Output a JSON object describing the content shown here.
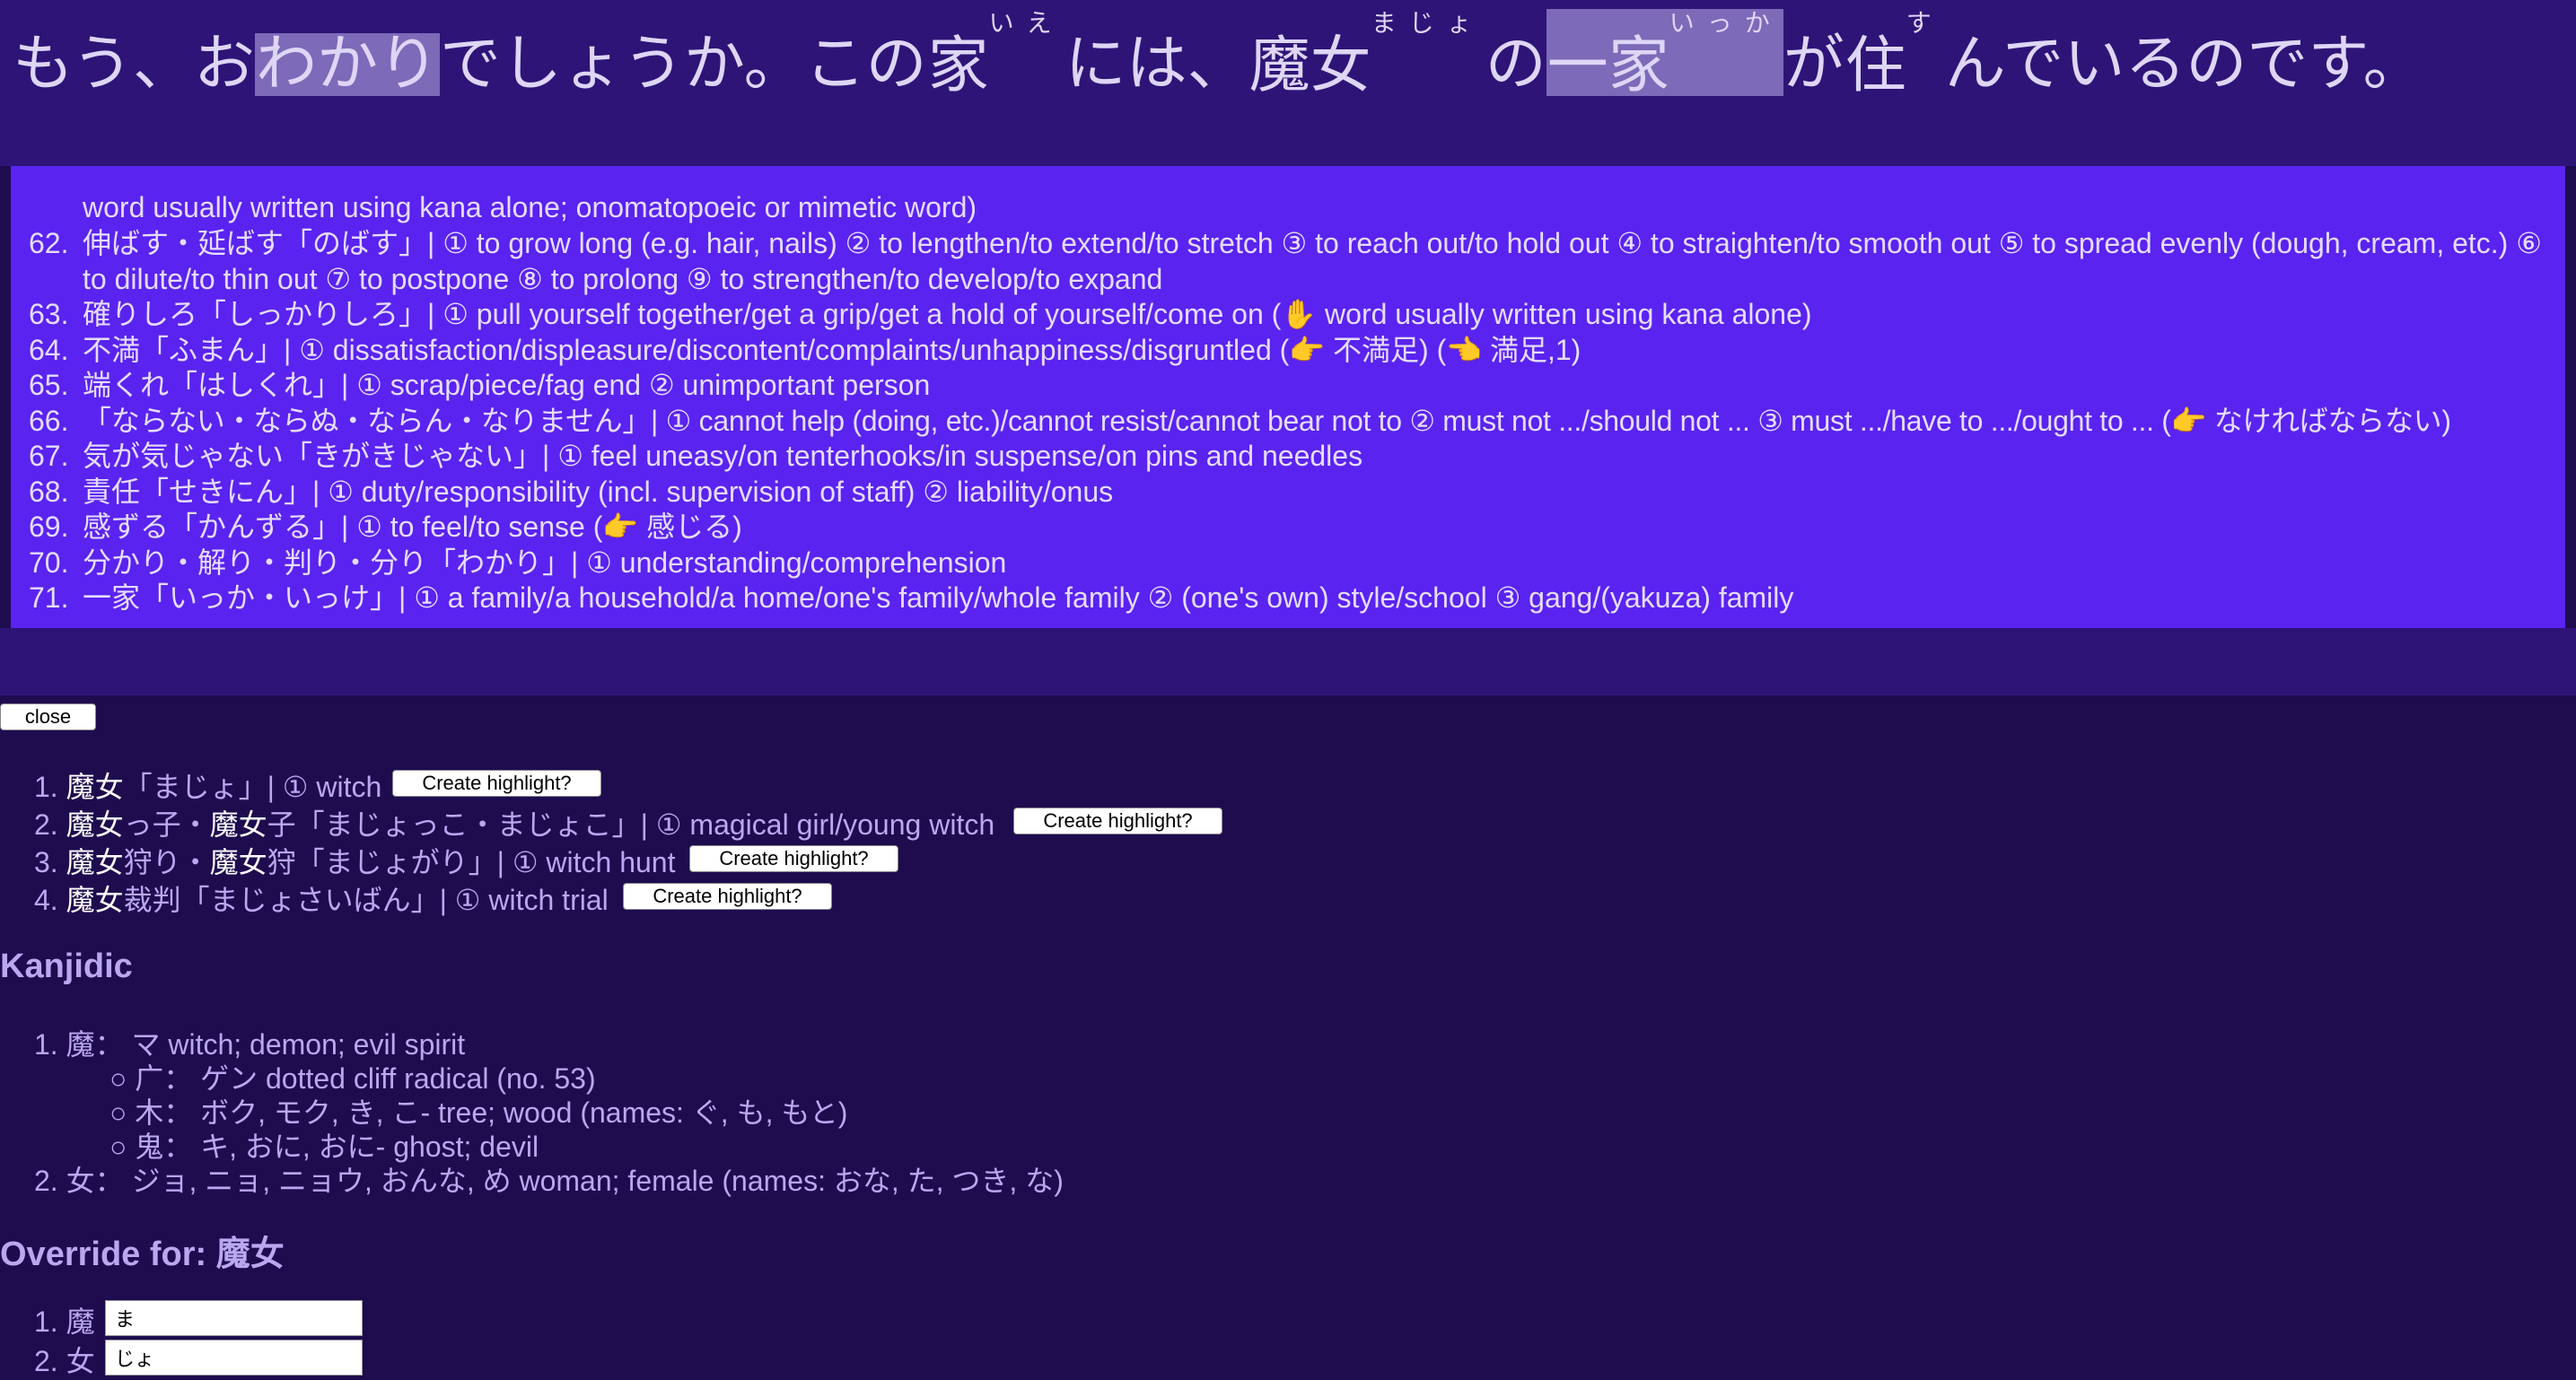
{
  "sentence": {
    "pre": "もう、お",
    "wakari": "わかり",
    "mid1": "でしょうか。この",
    "ie": {
      "base": "家",
      "ruby": "いえ"
    },
    "mid2": "には、",
    "majo": {
      "base": "魔女",
      "ruby": "まじょ"
    },
    "no": "の",
    "ikka": {
      "base": "一家",
      "ruby": "いっか"
    },
    "ga": "が",
    "su": {
      "base": "住",
      "ruby": "す"
    },
    "post": "んでいるのです。"
  },
  "dict_list": [
    {
      "num": "",
      "text": "word usually written using kana alone; onomatopoeic or mimetic word)"
    },
    {
      "num": "62.",
      "text": "伸ばす・延ばす「のばす」| ① to grow long (e.g. hair, nails) ② to lengthen/to extend/to stretch ③ to reach out/to hold out ④ to straighten/to smooth out ⑤ to spread evenly (dough, cream, etc.) ⑥ to dilute/to thin out ⑦ to postpone ⑧ to prolong ⑨ to strengthen/to develop/to expand"
    },
    {
      "num": "63.",
      "text": "確りしろ「しっかりしろ」| ① pull yourself together/get a grip/get a hold of yourself/come on (✋ word usually written using kana alone)"
    },
    {
      "num": "64.",
      "text": "不満「ふまん」| ① dissatisfaction/displeasure/discontent/complaints/unhappiness/disgruntled (👉 不満足) (👈 満足,1)"
    },
    {
      "num": "65.",
      "text": "端くれ「はしくれ」| ① scrap/piece/fag end ② unimportant person"
    },
    {
      "num": "66.",
      "text": "「ならない・ならぬ・ならん・なりません」| ① cannot help (doing, etc.)/cannot resist/cannot bear not to ② must not .../should not ... ③ must .../have to .../ought to ... (👉 なければならない)"
    },
    {
      "num": "67.",
      "text": "気が気じゃない「きがきじゃない」| ① feel uneasy/on tenterhooks/in suspense/on pins and needles"
    },
    {
      "num": "68.",
      "text": "責任「せきにん」| ① duty/responsibility (incl. supervision of staff) ② liability/onus"
    },
    {
      "num": "69.",
      "text": "感ずる「かんずる」| ① to feel/to sense (👉 感じる)"
    },
    {
      "num": "70.",
      "text": "分かり・解り・判り・分り「わかり」| ① understanding/comprehension"
    },
    {
      "num": "71.",
      "text": "一家「いっか・いっけ」| ① a family/a household/a home/one's family/whole family ② (one's own) style/school ③ gang/(yakuza) family"
    }
  ],
  "close_label": "close",
  "highlight_label": "Create highlight?",
  "results": [
    {
      "num": "1.",
      "w": "魔女",
      "rest": "「まじょ」| ① witch"
    },
    {
      "num": "2.",
      "w1": "魔女",
      "m": "っ子・",
      "w2": "魔女",
      "rest": "子「まじょっこ・まじょこ」| ① magical girl/young witch"
    },
    {
      "num": "3.",
      "w1": "魔女",
      "m": "狩り・",
      "w2": "魔女",
      "rest": "狩「まじょがり」| ① witch hunt"
    },
    {
      "num": "4.",
      "w": "魔女",
      "rest": "裁判「まじょさいばん」| ① witch trial"
    }
  ],
  "kanjidic": {
    "heading": "Kanjidic",
    "items": [
      {
        "num": "1.",
        "text": "魔： マ witch; demon; evil spirit"
      },
      {
        "num": "○",
        "text": "广： ゲン dotted cliff radical (no. 53)"
      },
      {
        "num": "○",
        "text": "木： ボク, モク, き, こ- tree; wood (names: ぐ, も, もと)"
      },
      {
        "num": "○",
        "text": "鬼： キ, おに, おに- ghost; devil"
      },
      {
        "num": "2.",
        "text": "女： ジョ, ニョ, ニョウ, おんな, め woman; female (names: おな, た, つき, な)"
      }
    ]
  },
  "override": {
    "heading": "Override for: 魔女",
    "rows": [
      {
        "num": "1.",
        "kanji": "魔",
        "value": "ま"
      },
      {
        "num": "2.",
        "kanji": "女",
        "value": "じょ"
      }
    ]
  }
}
